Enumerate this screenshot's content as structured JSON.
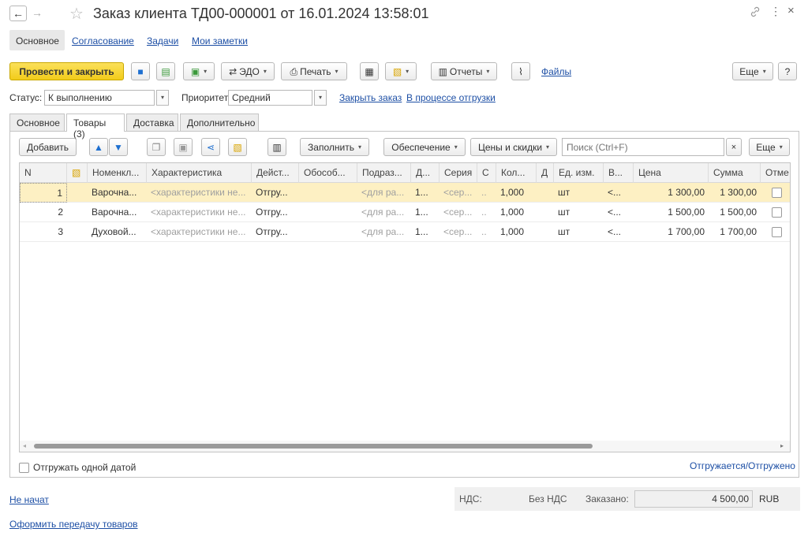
{
  "window": {
    "title": "Заказ клиента ТД00-000001 от 16.01.2024 13:58:01",
    "back_glyph": "←",
    "fwd_glyph": "→",
    "star_glyph": "☆",
    "link_glyph": "🔗",
    "more_glyph": "⋮",
    "close_glyph": "×"
  },
  "top_tabs": [
    "Основное",
    "Согласование",
    "Задачи",
    "Мои заметки"
  ],
  "toolbar": {
    "post_close": "Провести и закрыть",
    "edo": "ЭДО",
    "print": "Печать",
    "reports": "Отчеты",
    "files": "Файлы",
    "more": "Еще",
    "help": "?"
  },
  "status_row": {
    "status_label": "Статус:",
    "status_value": "К выполнению",
    "priority_label": "Приоритет:",
    "priority_value": "Средний",
    "close_order": "Закрыть заказ",
    "in_shipment": "В процессе отгрузки"
  },
  "form_tabs": [
    "Основное",
    "Товары (3)",
    "Доставка",
    "Дополнительно"
  ],
  "grid_toolbar": {
    "add": "Добавить",
    "fill": "Заполнить",
    "supply": "Обеспечение",
    "prices": "Цены и скидки",
    "search_placeholder": "Поиск (Ctrl+F)",
    "clear": "×",
    "more": "Еще"
  },
  "grid": {
    "headers": [
      "N",
      "",
      "Номенкл...",
      "Характеристика",
      "Дейст...",
      "Обособ...",
      "Подраз...",
      "Д...",
      "Серия",
      "С",
      "Кол...",
      "Д",
      "Ед. изм.",
      "В...",
      "Цена",
      "Сумма",
      "Отме"
    ],
    "rows": [
      [
        "1",
        "",
        "Варочна...",
        "<характеристики не...",
        "Отгру...",
        "",
        "<для ра...",
        "1...",
        "<сер...",
        "..",
        "1,000",
        "",
        "шт",
        "<...",
        "1 300,00",
        "1 300,00",
        ""
      ],
      [
        "2",
        "",
        "Варочна...",
        "<характеристики не...",
        "Отгру...",
        "",
        "<для ра...",
        "1...",
        "<сер...",
        "..",
        "1,000",
        "",
        "шт",
        "<...",
        "1 500,00",
        "1 500,00",
        ""
      ],
      [
        "3",
        "",
        "Духовой...",
        "<характеристики не...",
        "Отгру...",
        "",
        "<для ра...",
        "1...",
        "<сер...",
        "..",
        "1,000",
        "",
        "шт",
        "<...",
        "1 700,00",
        "1 700,00",
        ""
      ]
    ],
    "selected_row": 0
  },
  "ship_one_date": "Отгружать одной датой",
  "shipped_link": "Отгружается/Отгружено",
  "footer": {
    "not_started": "Не начат",
    "transfer": "Оформить передачу товаров",
    "vat_label": "НДС:",
    "vat_value": "Без НДС",
    "ordered_label": "Заказано:",
    "ordered_value": "4 500,00",
    "currency": "RUB"
  },
  "colors": {
    "primary_button": "#f5d21c",
    "selected_row": "#fdf0c3",
    "link": "#1d4fa5"
  }
}
